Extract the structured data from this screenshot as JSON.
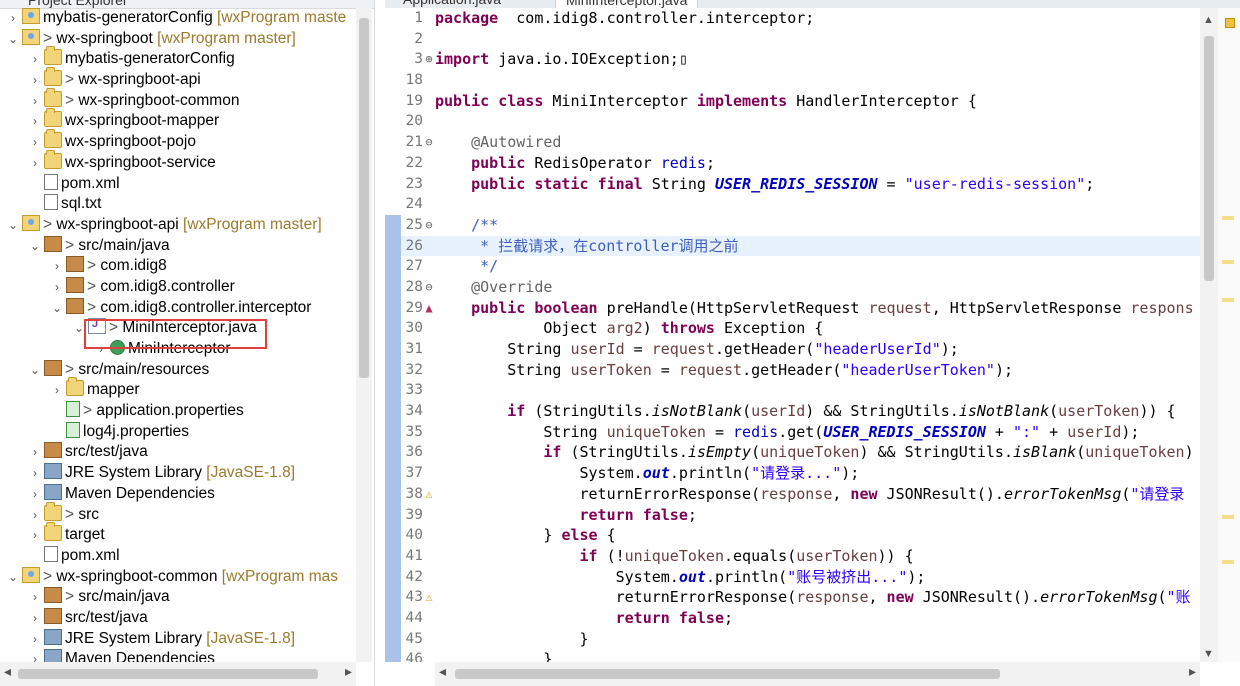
{
  "left_pane": {
    "title": "Project Explorer",
    "tree": [
      {
        "indent": 0,
        "arrow": ">",
        "icon": "project",
        "prefix": "",
        "label": "mybatis-generatorConfig",
        "deco": " [wxProgram maste"
      },
      {
        "indent": 0,
        "arrow": "v",
        "icon": "project",
        "prefix": "> ",
        "label": "wx-springboot",
        "deco": " [wxProgram master]"
      },
      {
        "indent": 1,
        "arrow": ">",
        "icon": "folder",
        "prefix": "",
        "label": "mybatis-generatorConfig",
        "deco": ""
      },
      {
        "indent": 1,
        "arrow": ">",
        "icon": "folder",
        "prefix": "> ",
        "label": "wx-springboot-api",
        "deco": ""
      },
      {
        "indent": 1,
        "arrow": ">",
        "icon": "folder",
        "prefix": "> ",
        "label": "wx-springboot-common",
        "deco": ""
      },
      {
        "indent": 1,
        "arrow": ">",
        "icon": "folder",
        "prefix": "",
        "label": "wx-springboot-mapper",
        "deco": ""
      },
      {
        "indent": 1,
        "arrow": ">",
        "icon": "folder",
        "prefix": "",
        "label": "wx-springboot-pojo",
        "deco": ""
      },
      {
        "indent": 1,
        "arrow": ">",
        "icon": "folder",
        "prefix": "",
        "label": "wx-springboot-service",
        "deco": ""
      },
      {
        "indent": 1,
        "arrow": "",
        "icon": "file",
        "prefix": "",
        "label": "pom.xml",
        "deco": ""
      },
      {
        "indent": 1,
        "arrow": "",
        "icon": "file",
        "prefix": "",
        "label": "sql.txt",
        "deco": ""
      },
      {
        "indent": 0,
        "arrow": "v",
        "icon": "project",
        "prefix": "> ",
        "label": "wx-springboot-api",
        "deco": " [wxProgram master]"
      },
      {
        "indent": 1,
        "arrow": "v",
        "icon": "package",
        "prefix": "> ",
        "label": "src/main/java",
        "deco": ""
      },
      {
        "indent": 2,
        "arrow": ">",
        "icon": "package",
        "prefix": "> ",
        "label": "com.idig8",
        "deco": ""
      },
      {
        "indent": 2,
        "arrow": ">",
        "icon": "package",
        "prefix": "> ",
        "label": "com.idig8.controller",
        "deco": ""
      },
      {
        "indent": 2,
        "arrow": "v",
        "icon": "package",
        "prefix": "> ",
        "label": "com.idig8.controller.interceptor",
        "deco": ""
      },
      {
        "indent": 3,
        "arrow": "v",
        "icon": "javafile",
        "prefix": "> ",
        "label": "MiniInterceptor.java",
        "deco": ""
      },
      {
        "indent": 4,
        "arrow": ">",
        "icon": "class",
        "prefix": "",
        "label": "MiniInterceptor",
        "deco": ""
      },
      {
        "indent": 1,
        "arrow": "v",
        "icon": "package",
        "prefix": "> ",
        "label": "src/main/resources",
        "deco": ""
      },
      {
        "indent": 2,
        "arrow": ">",
        "icon": "folder",
        "prefix": "",
        "label": "mapper",
        "deco": ""
      },
      {
        "indent": 2,
        "arrow": "",
        "icon": "props",
        "prefix": "> ",
        "label": "application.properties",
        "deco": ""
      },
      {
        "indent": 2,
        "arrow": "",
        "icon": "props",
        "prefix": "",
        "label": "log4j.properties",
        "deco": ""
      },
      {
        "indent": 1,
        "arrow": ">",
        "icon": "package",
        "prefix": "",
        "label": "src/test/java",
        "deco": ""
      },
      {
        "indent": 1,
        "arrow": ">",
        "icon": "lib",
        "prefix": "",
        "label": "JRE System Library",
        "deco": " [JavaSE-1.8]"
      },
      {
        "indent": 1,
        "arrow": ">",
        "icon": "lib",
        "prefix": "",
        "label": "Maven Dependencies",
        "deco": ""
      },
      {
        "indent": 1,
        "arrow": ">",
        "icon": "folder",
        "prefix": "> ",
        "label": "src",
        "deco": ""
      },
      {
        "indent": 1,
        "arrow": ">",
        "icon": "folder",
        "prefix": "",
        "label": "target",
        "deco": ""
      },
      {
        "indent": 1,
        "arrow": "",
        "icon": "file",
        "prefix": "",
        "label": "pom.xml",
        "deco": ""
      },
      {
        "indent": 0,
        "arrow": "v",
        "icon": "project",
        "prefix": "> ",
        "label": "wx-springboot-common",
        "deco": " [wxProgram mas"
      },
      {
        "indent": 1,
        "arrow": ">",
        "icon": "package",
        "prefix": "> ",
        "label": "src/main/java",
        "deco": ""
      },
      {
        "indent": 1,
        "arrow": ">",
        "icon": "package",
        "prefix": "",
        "label": "src/test/java",
        "deco": ""
      },
      {
        "indent": 1,
        "arrow": ">",
        "icon": "lib",
        "prefix": "",
        "label": "JRE System Library",
        "deco": " [JavaSE-1.8]"
      },
      {
        "indent": 1,
        "arrow": ">",
        "icon": "lib",
        "prefix": "",
        "label": "Maven Dependencies",
        "deco": ""
      }
    ]
  },
  "editor": {
    "tabs": [
      {
        "label": "Application.java",
        "active": false
      },
      {
        "label": "MiniInterceptor.java",
        "active": true
      }
    ],
    "current_line": "26",
    "lines": [
      {
        "n": "1",
        "tokens": [
          [
            "kw",
            "package"
          ],
          [
            "",
            "  com.idig8.controller.interceptor;"
          ]
        ]
      },
      {
        "n": "2",
        "tokens": []
      },
      {
        "n": "3",
        "gutter": "⊕",
        "tokens": [
          [
            "kw",
            "import"
          ],
          [
            "",
            " java.io.IOException;"
          ],
          [
            "",
            "▯"
          ]
        ]
      },
      {
        "n": "18",
        "tokens": []
      },
      {
        "n": "19",
        "tokens": [
          [
            "kw",
            "public"
          ],
          [
            "",
            " "
          ],
          [
            "kw",
            "class"
          ],
          [
            "",
            " MiniInterceptor "
          ],
          [
            "kw",
            "implements"
          ],
          [
            "",
            " HandlerInterceptor {"
          ]
        ]
      },
      {
        "n": "20",
        "tokens": []
      },
      {
        "n": "21",
        "gutter": "⊖",
        "tokens": [
          [
            "",
            "    "
          ],
          [
            "ann",
            "@Autowired"
          ]
        ]
      },
      {
        "n": "22",
        "tokens": [
          [
            "",
            "    "
          ],
          [
            "kw",
            "public"
          ],
          [
            "",
            " RedisOperator "
          ],
          [
            "fld",
            "redis"
          ],
          [
            "",
            ";"
          ]
        ]
      },
      {
        "n": "23",
        "tokens": [
          [
            "",
            "    "
          ],
          [
            "kw",
            "public"
          ],
          [
            "",
            " "
          ],
          [
            "kw",
            "static"
          ],
          [
            "",
            " "
          ],
          [
            "kw",
            "final"
          ],
          [
            "",
            " String "
          ],
          [
            "sfld",
            "USER_REDIS_SESSION"
          ],
          [
            "",
            " = "
          ],
          [
            "str",
            "\"user-redis-session\""
          ],
          [
            "",
            ";"
          ]
        ]
      },
      {
        "n": "24",
        "tokens": []
      },
      {
        "n": "25",
        "gutter": "⊖",
        "ruler": true,
        "tokens": [
          [
            "",
            "    "
          ],
          [
            "cmt",
            "/**"
          ]
        ]
      },
      {
        "n": "26",
        "ruler": true,
        "tokens": [
          [
            "cmt",
            "     * 拦截请求，在controller调用之前"
          ]
        ]
      },
      {
        "n": "27",
        "ruler": true,
        "tokens": [
          [
            "cmt",
            "     */"
          ]
        ]
      },
      {
        "n": "28",
        "gutter": "⊖",
        "ruler": true,
        "tokens": [
          [
            "",
            "    "
          ],
          [
            "ann",
            "@Override"
          ]
        ]
      },
      {
        "n": "29",
        "gutter": "▲",
        "ruler": true,
        "tokens": [
          [
            "",
            "    "
          ],
          [
            "kw",
            "public"
          ],
          [
            "",
            " "
          ],
          [
            "kw",
            "boolean"
          ],
          [
            "",
            " preHandle(HttpServletRequest "
          ],
          [
            "var",
            "request"
          ],
          [
            "",
            ", HttpServletResponse "
          ],
          [
            "var",
            "respons"
          ]
        ]
      },
      {
        "n": "30",
        "ruler": true,
        "tokens": [
          [
            "",
            "            Object "
          ],
          [
            "var",
            "arg2"
          ],
          [
            "",
            ") "
          ],
          [
            "kw",
            "throws"
          ],
          [
            "",
            " Exception {"
          ]
        ]
      },
      {
        "n": "31",
        "ruler": true,
        "tokens": [
          [
            "",
            "        String "
          ],
          [
            "var",
            "userId"
          ],
          [
            "",
            " = "
          ],
          [
            "var",
            "request"
          ],
          [
            "",
            ".getHeader("
          ],
          [
            "str",
            "\"headerUserId\""
          ],
          [
            "",
            ");"
          ]
        ]
      },
      {
        "n": "32",
        "ruler": true,
        "tokens": [
          [
            "",
            "        String "
          ],
          [
            "var",
            "userToken"
          ],
          [
            "",
            " = "
          ],
          [
            "var",
            "request"
          ],
          [
            "",
            ".getHeader("
          ],
          [
            "str",
            "\"headerUserToken\""
          ],
          [
            "",
            ");"
          ]
        ]
      },
      {
        "n": "33",
        "ruler": true,
        "tokens": []
      },
      {
        "n": "34",
        "ruler": true,
        "tokens": [
          [
            "",
            "        "
          ],
          [
            "kw",
            "if"
          ],
          [
            "",
            " (StringUtils."
          ],
          [
            "smeth",
            "isNotBlank"
          ],
          [
            "",
            "("
          ],
          [
            "var",
            "userId"
          ],
          [
            "",
            ") && StringUtils."
          ],
          [
            "smeth",
            "isNotBlank"
          ],
          [
            "",
            "("
          ],
          [
            "var",
            "userToken"
          ],
          [
            "",
            ")) {"
          ]
        ]
      },
      {
        "n": "35",
        "ruler": true,
        "tokens": [
          [
            "",
            "            String "
          ],
          [
            "var",
            "uniqueToken"
          ],
          [
            "",
            " = "
          ],
          [
            "fld",
            "redis"
          ],
          [
            "",
            ".get("
          ],
          [
            "sfld",
            "USER_REDIS_SESSION"
          ],
          [
            "",
            " + "
          ],
          [
            "str",
            "\":\""
          ],
          [
            "",
            " + "
          ],
          [
            "var",
            "userId"
          ],
          [
            "",
            ");"
          ]
        ]
      },
      {
        "n": "36",
        "ruler": true,
        "tokens": [
          [
            "",
            "            "
          ],
          [
            "kw",
            "if"
          ],
          [
            "",
            " (StringUtils."
          ],
          [
            "smeth",
            "isEmpty"
          ],
          [
            "",
            "("
          ],
          [
            "var",
            "uniqueToken"
          ],
          [
            "",
            ") && StringUtils."
          ],
          [
            "smeth",
            "isBlank"
          ],
          [
            "",
            "("
          ],
          [
            "var",
            "uniqueToken"
          ],
          [
            "",
            ")"
          ]
        ]
      },
      {
        "n": "37",
        "ruler": true,
        "tokens": [
          [
            "",
            "                System."
          ],
          [
            "sfld",
            "out"
          ],
          [
            "",
            ".println("
          ],
          [
            "str",
            "\"请登录...\""
          ],
          [
            "",
            ");"
          ]
        ]
      },
      {
        "n": "38",
        "gutter": "⚠",
        "ruler": true,
        "tokens": [
          [
            "",
            "                returnErrorResponse("
          ],
          [
            "var",
            "response"
          ],
          [
            "",
            ", "
          ],
          [
            "kw",
            "new"
          ],
          [
            "",
            " JSONResult()."
          ],
          [
            "smeth",
            "errorTokenMsg"
          ],
          [
            "",
            "("
          ],
          [
            "str",
            "\"请登录"
          ]
        ]
      },
      {
        "n": "39",
        "ruler": true,
        "tokens": [
          [
            "",
            "                "
          ],
          [
            "kw",
            "return"
          ],
          [
            "",
            " "
          ],
          [
            "kw",
            "false"
          ],
          [
            "",
            ";"
          ]
        ]
      },
      {
        "n": "40",
        "ruler": true,
        "tokens": [
          [
            "",
            "            } "
          ],
          [
            "kw",
            "else"
          ],
          [
            "",
            " {"
          ]
        ]
      },
      {
        "n": "41",
        "ruler": true,
        "tokens": [
          [
            "",
            "                "
          ],
          [
            "kw",
            "if"
          ],
          [
            "",
            " (!"
          ],
          [
            "var",
            "uniqueToken"
          ],
          [
            "",
            ".equals("
          ],
          [
            "var",
            "userToken"
          ],
          [
            "",
            ")) {"
          ]
        ]
      },
      {
        "n": "42",
        "ruler": true,
        "tokens": [
          [
            "",
            "                    System."
          ],
          [
            "sfld",
            "out"
          ],
          [
            "",
            ".println("
          ],
          [
            "str",
            "\"账号被挤出...\""
          ],
          [
            "",
            ");"
          ]
        ]
      },
      {
        "n": "43",
        "gutter": "⚠",
        "ruler": true,
        "tokens": [
          [
            "",
            "                    returnErrorResponse("
          ],
          [
            "var",
            "response"
          ],
          [
            "",
            ", "
          ],
          [
            "kw",
            "new"
          ],
          [
            "",
            " JSONResult()."
          ],
          [
            "smeth",
            "errorTokenMsg"
          ],
          [
            "",
            "("
          ],
          [
            "str",
            "\"账"
          ]
        ]
      },
      {
        "n": "44",
        "ruler": true,
        "tokens": [
          [
            "",
            "                    "
          ],
          [
            "kw",
            "return"
          ],
          [
            "",
            " "
          ],
          [
            "kw",
            "false"
          ],
          [
            "",
            ";"
          ]
        ]
      },
      {
        "n": "45",
        "ruler": true,
        "tokens": [
          [
            "",
            "                }"
          ]
        ]
      },
      {
        "n": "46",
        "ruler": true,
        "tokens": [
          [
            "",
            "            }"
          ]
        ]
      }
    ]
  },
  "icons": {
    "left": "◂",
    "right": "▸",
    "up": "▲",
    "down": "▼"
  }
}
